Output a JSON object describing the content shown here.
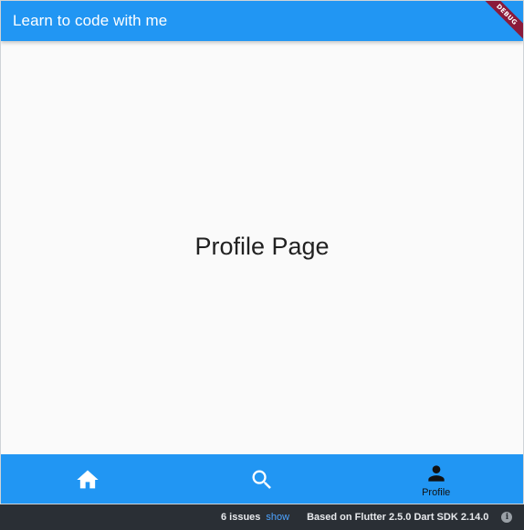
{
  "appbar": {
    "title": "Learn to code with me"
  },
  "debug_banner": {
    "label": "DEBUG"
  },
  "main": {
    "text": "Profile Page"
  },
  "bottom_nav": {
    "items": [
      {
        "icon": "home-icon",
        "label": "",
        "active": false
      },
      {
        "icon": "search-icon",
        "label": "",
        "active": false
      },
      {
        "icon": "person-icon",
        "label": "Profile",
        "active": true
      }
    ]
  },
  "status_bar": {
    "issues": "6 issues",
    "show": "show",
    "info": "Based on Flutter 2.5.0 Dart SDK 2.14.0",
    "info_icon": "info-icon"
  },
  "colors": {
    "primary": "#2196f3",
    "background": "#fafafa",
    "status_bg": "#2a2f35",
    "debug_ribbon": "#8b1a3a",
    "link": "#4da3ff"
  }
}
